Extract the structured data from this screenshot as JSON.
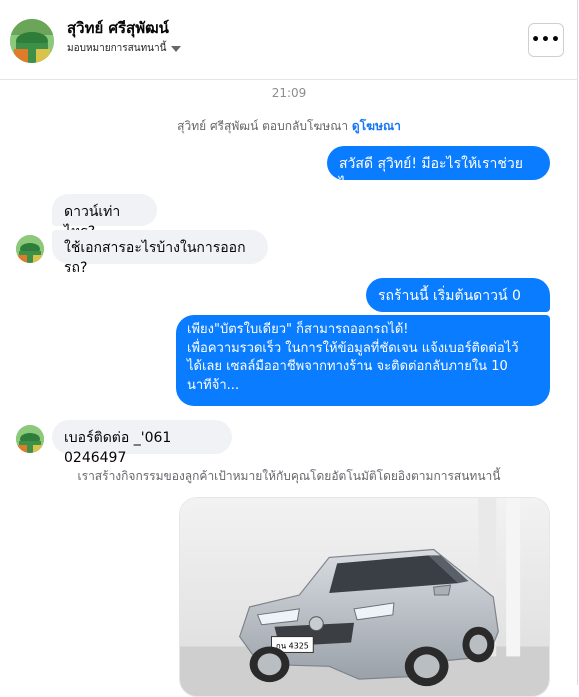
{
  "header": {
    "name": "สุวิทย์ ศรีสุพัฒน์",
    "subtitle": "มอบหมายการสนทนานี้",
    "more_label": "•••"
  },
  "conversation": {
    "timestamp": "21:09",
    "ad_reply_text": "สุวิทย์ ศรีสุพัฒน์ ตอบกลับโฆษณา",
    "ad_reply_link": "ดูโฆษณา",
    "messages": [
      {
        "from": "page",
        "text": "สวัสดี สุวิทย์! มีอะไรให้เราช่วยไหม"
      },
      {
        "from": "customer",
        "text": "ดาวน์เท่าไหร?"
      },
      {
        "from": "customer",
        "text": "ใช้เอกสารอะไรบ้างในการออกรถ?"
      },
      {
        "from": "page",
        "text": "รถร้านนี้ เริ่มต้นดาวน์ 0 บาท"
      },
      {
        "from": "page",
        "lines": [
          "เพียง\"บัตรใบเดียว\" ก็สามารถออกรถได้!",
          "เพื่อความรวดเร็ว ในการให้ข้อมูลที่ชัดเจน แจ้งเบอร์ติดต่อไว้",
          "ได้เลย เซลล์มืออาชีพจากทางร้าน จะติดต่อกลับภายใน 10",
          "นาทีจ้า..."
        ]
      },
      {
        "from": "customer",
        "text": "เบอร์ติดต่อ _'061 0246497"
      }
    ],
    "ad_note": "เราสร้างกิจกรรมของลูกค้าเป้าหมายให้กับคุณโดยอัตโนมัติโดยอิงตามการสนทนานี้",
    "card": {
      "image_name": "car-photo",
      "plate_text": "กน 4325"
    }
  },
  "colors": {
    "outgoing_bubble": "#0a7cff",
    "incoming_bubble": "#f0f2f5",
    "link": "#1877f2"
  }
}
